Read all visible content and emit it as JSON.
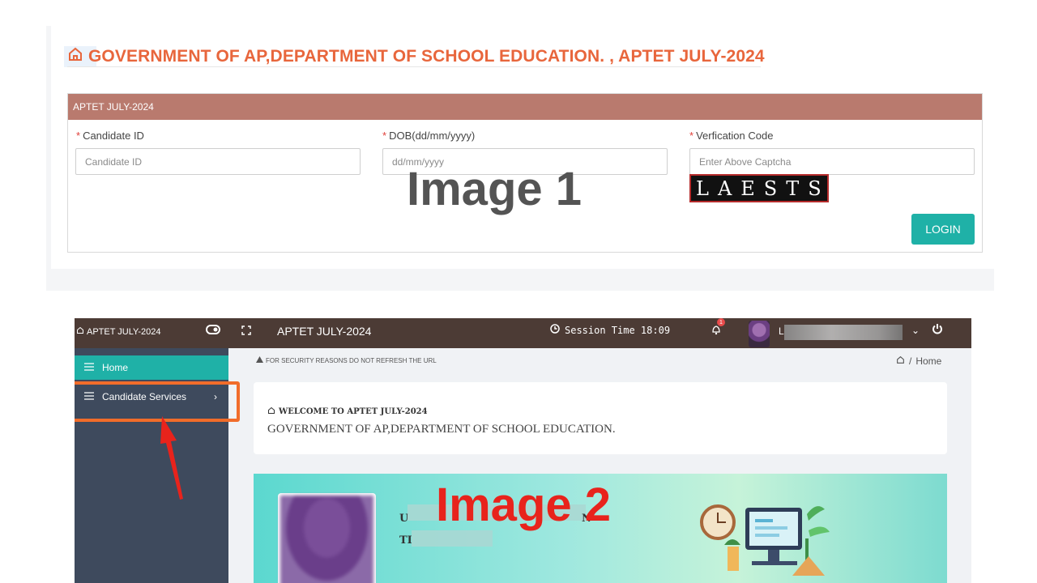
{
  "image1": {
    "title": "GOVERNMENT OF AP,DEPARTMENT OF SCHOOL EDUCATION. , APTET JULY-2024",
    "panel_header": "APTET JULY-2024",
    "fields": [
      {
        "label": "Candidate ID",
        "placeholder": "Candidate ID"
      },
      {
        "label": "DOB(dd/mm/yyyy)",
        "placeholder": "dd/mm/yyyy"
      },
      {
        "label": "Verfication Code",
        "placeholder": "Enter Above Captcha"
      }
    ],
    "required_marker": "*",
    "captcha_text": "LAESTS",
    "login_label": "LOGIN",
    "overlay_label": "Image 1"
  },
  "image2": {
    "topbar": {
      "brand": "APTET JULY-2024",
      "title": "APTET JULY-2024",
      "session_label": "Session Time 18:09",
      "notification_count": "1",
      "user_initial": "L",
      "caret": "⌄",
      "power_icon": "power-icon"
    },
    "sidebar": {
      "items": [
        {
          "label": "Home",
          "active": true
        },
        {
          "label": "Candidate Services",
          "active": false,
          "chevron": "›"
        }
      ]
    },
    "security_notice": "FOR SECURITY REASONS DO NOT REFRESH THE URL",
    "breadcrumb": {
      "separator": "/",
      "current": "Home"
    },
    "welcome": {
      "heading": "WELCOME TO APTET JULY-2024",
      "subtitle": "GOVERNMENT OF AP,DEPARTMENT OF SCHOOL EDUCATION."
    },
    "banner": {
      "line1_prefix": "U",
      "line1_suffix": "N",
      "line2_prefix": "TI"
    },
    "overlay_label": "Image 2",
    "highlight_color": "#f16c2a",
    "arrow_color": "#e8231c"
  },
  "colors": {
    "title_orange": "#e8663c",
    "panel_header": "#b97a6e",
    "login_teal": "#1fb1a7",
    "topbar": "#4c3b35",
    "sidebar": "#3e4a5d"
  }
}
